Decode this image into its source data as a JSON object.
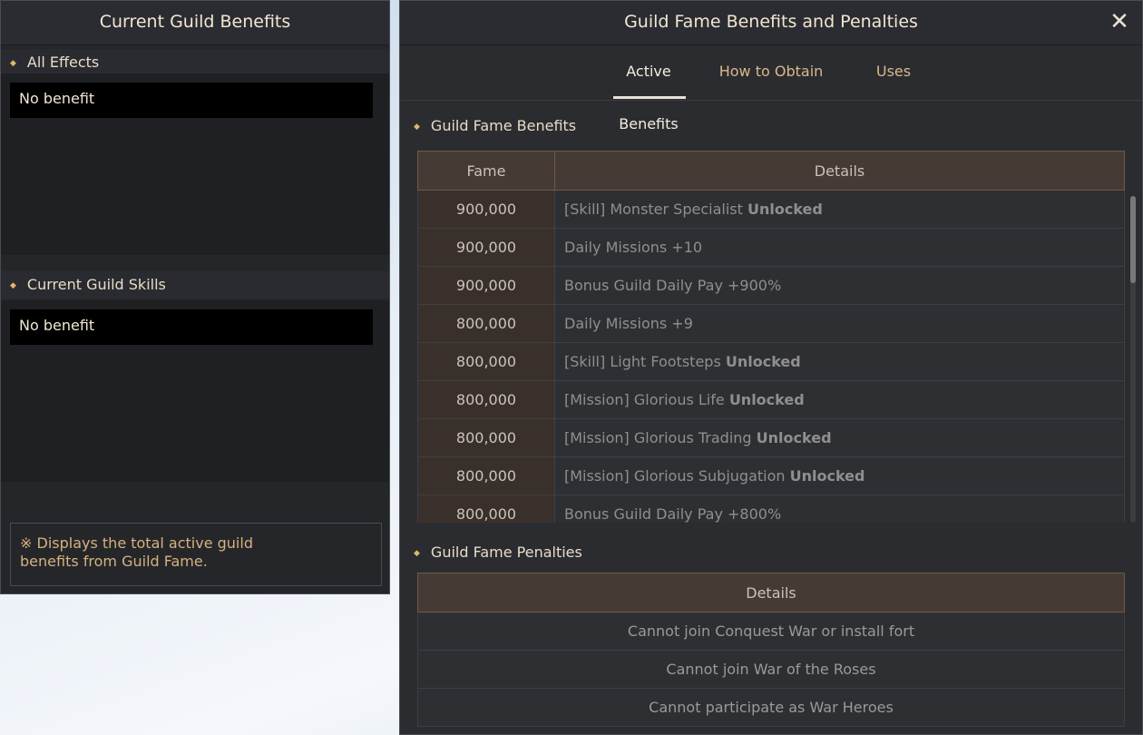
{
  "left_panel": {
    "title": "Current Guild Benefits",
    "sections": [
      {
        "heading": "All Effects",
        "value": "No benefit"
      },
      {
        "heading": "Current Guild Skills",
        "value": "No benefit"
      }
    ],
    "note_prefix": "※",
    "note_text": "Displays the total active guild benefits from Guild Fame."
  },
  "right_panel": {
    "title": "Guild Fame Benefits and Penalties",
    "close_icon": "close-icon",
    "tabs": [
      {
        "label": "Active Benefits",
        "active": true
      },
      {
        "label": "How to Obtain",
        "active": false
      },
      {
        "label": "Uses",
        "active": false
      }
    ],
    "benefits_heading": "Guild Fame Benefits",
    "benefits_headers": {
      "fame": "Fame",
      "details": "Details"
    },
    "benefits": [
      {
        "fame": "900,000",
        "text": "[Skill] Monster Specialist",
        "suffix": "Unlocked"
      },
      {
        "fame": "900,000",
        "text": "Daily Missions",
        "suffix": "+10"
      },
      {
        "fame": "900,000",
        "text": "Bonus Guild Daily Pay",
        "suffix": "+900%"
      },
      {
        "fame": "800,000",
        "text": "Daily Missions",
        "suffix": "+9"
      },
      {
        "fame": "800,000",
        "text": "[Skill] Light Footsteps",
        "suffix": "Unlocked"
      },
      {
        "fame": "800,000",
        "text": "[Mission] Glorious Life",
        "suffix": "Unlocked"
      },
      {
        "fame": "800,000",
        "text": "[Mission] Glorious Trading",
        "suffix": "Unlocked"
      },
      {
        "fame": "800,000",
        "text": "[Mission] Glorious Subjugation",
        "suffix": "Unlocked"
      },
      {
        "fame": "800,000",
        "text": "Bonus Guild Daily Pay",
        "suffix": "+800%"
      }
    ],
    "penalties_heading": "Guild Fame Penalties",
    "penalties_header": "Details",
    "penalties": [
      "Cannot join Conquest War or install fort",
      "Cannot join War of the Roses",
      "Cannot participate as War Heroes"
    ],
    "scroll_position": 0
  }
}
